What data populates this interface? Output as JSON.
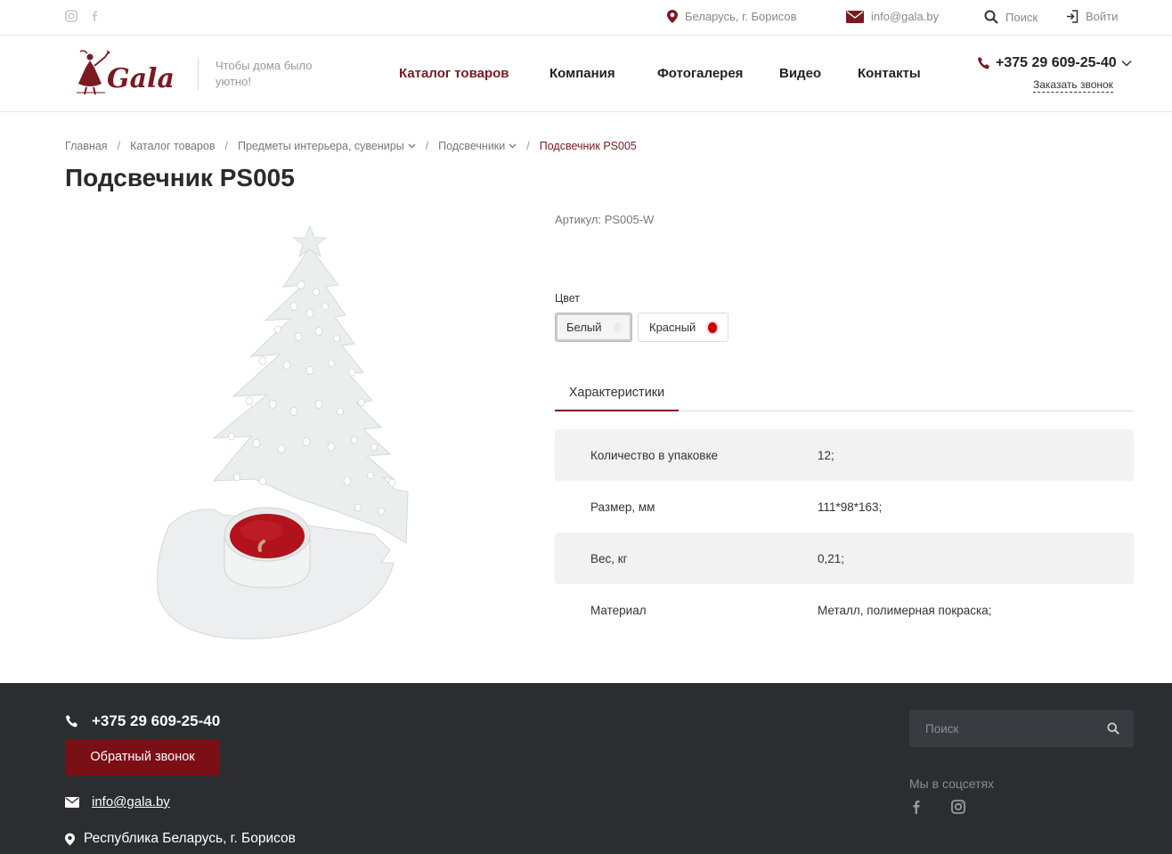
{
  "topbar": {
    "location": "Беларусь, г. Борисов",
    "email": "info@gala.by",
    "search": "Поиск",
    "login": "Войти"
  },
  "header": {
    "logo_text": "Gala",
    "slogan": "Чтобы дома было уютно!",
    "nav": [
      "Каталог товаров",
      "Компания",
      "Фотогалерея",
      "Видео",
      "Контакты"
    ],
    "phone": "+375 29 609-25-40",
    "callback": "Заказать звонок"
  },
  "breadcrumbs": [
    "Главная",
    "Каталог товаров",
    "Предметы интерьера, сувениры",
    "Подсвечники",
    "Подсвечник PS005"
  ],
  "product": {
    "title": "Подсвечник PS005",
    "sku": "Артикул: PS005-W",
    "color_label": "Цвет",
    "colors": [
      {
        "name": "Белый",
        "swatch": "#e8ebea"
      },
      {
        "name": "Красный",
        "swatch": "#cc0000"
      }
    ],
    "tab": "Характеристики",
    "specs": [
      {
        "name": "Количество в упаковке",
        "value": "12;"
      },
      {
        "name": "Размер, мм",
        "value": "111*98*163;"
      },
      {
        "name": "Вес, кг",
        "value": "0,21;"
      },
      {
        "name": "Материал",
        "value": "Металл, полимерная покраска;"
      }
    ]
  },
  "footer": {
    "phone": "+375 29 609-25-40",
    "callback_button": "Обратный звонок",
    "email": "info@gala.by",
    "address": "Республика Беларусь, г. Борисов",
    "search_placeholder": "Поиск",
    "social_label": "Мы в соцсетях"
  },
  "colors": {
    "brand": "#7a1a22",
    "footer_bg": "#2c2d31"
  }
}
